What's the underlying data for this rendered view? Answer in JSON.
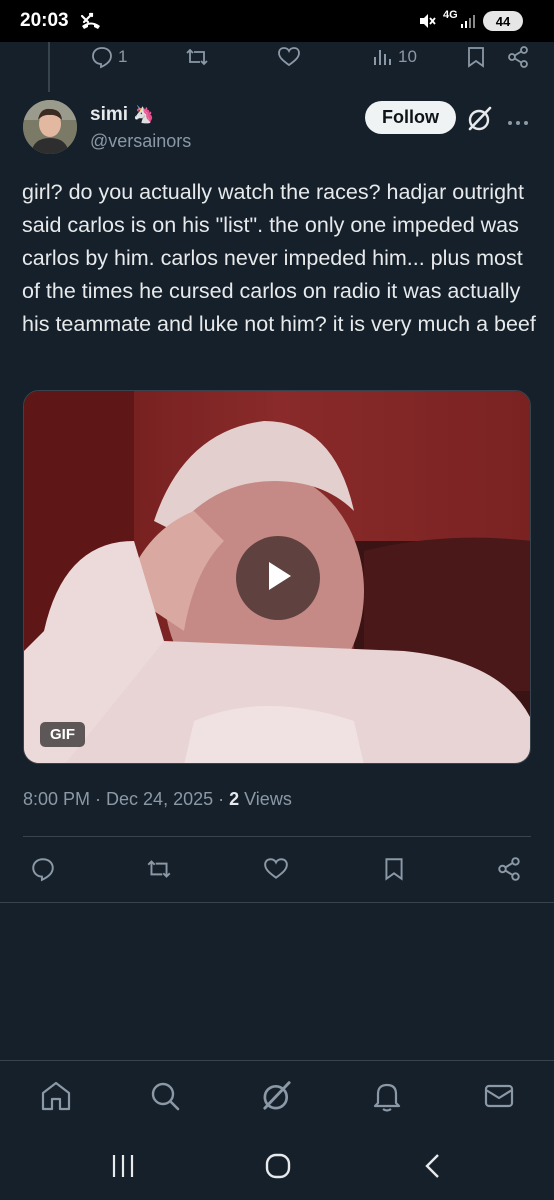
{
  "status_bar": {
    "time": "20:03",
    "network": "4G",
    "battery": "44"
  },
  "parent_actions": {
    "reply_count": "1",
    "views_count": "10"
  },
  "tweet": {
    "display_name": "simi",
    "emoji": "🦄",
    "handle": "@versainors",
    "follow_label": "Follow",
    "text": "girl? do you actually watch the races? hadjar outright said carlos is on his \"list\". the only one impeded was carlos by him. carlos never impeded him... plus most of the times he cursed carlos on radio it was actually his teammate and luke not him? it is very much a beef",
    "media_badge": "GIF",
    "timestamp": "8:00 PM · Dec 24, 2025 · ",
    "views_count": "2",
    "views_label": " Views"
  },
  "icons": {
    "reply": "reply-icon",
    "retweet": "retweet-icon",
    "like": "heart-icon",
    "views": "views-icon",
    "bookmark": "bookmark-icon",
    "share": "share-icon",
    "grok": "grok-icon",
    "more": "more-icon"
  },
  "colors": {
    "background": "#15202b",
    "text": "#e7e9ea",
    "muted": "#8b98a5",
    "border": "#38444d"
  }
}
